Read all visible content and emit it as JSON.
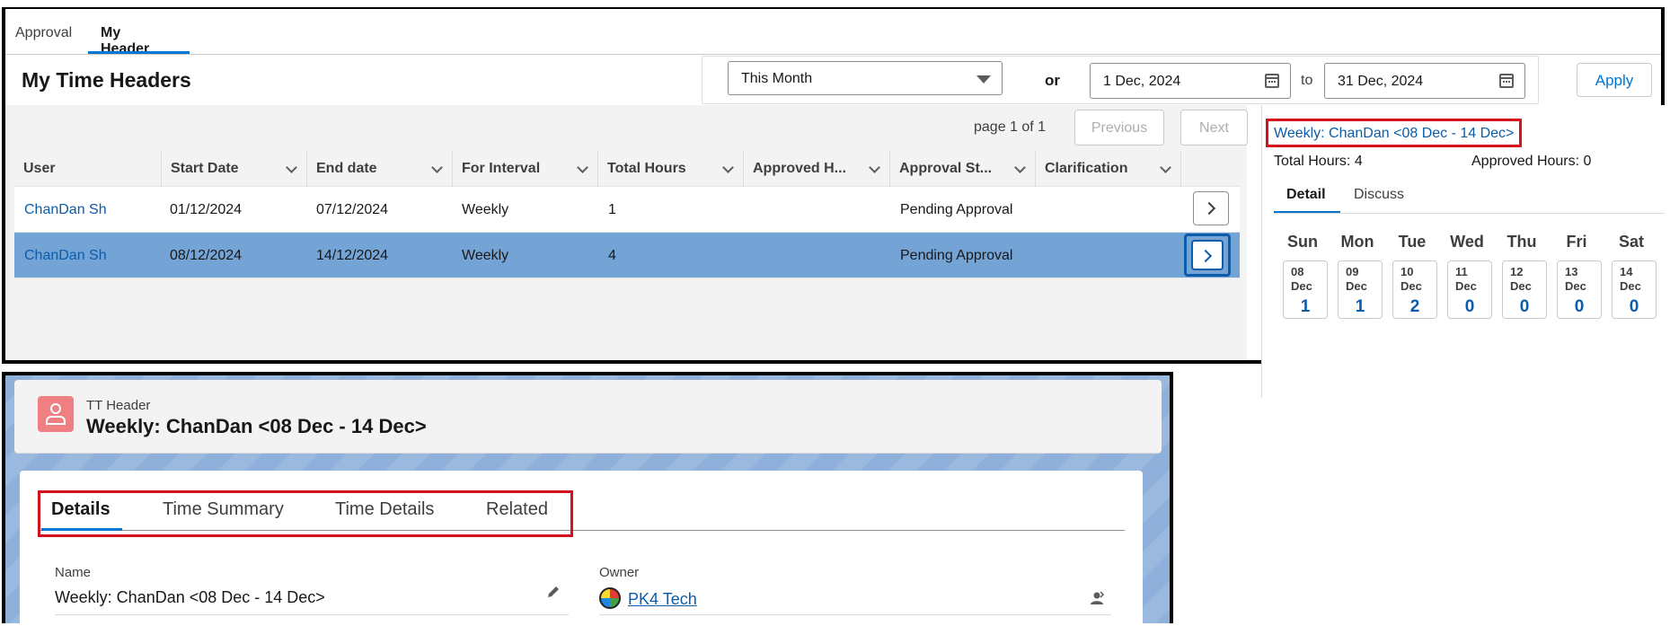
{
  "tabs": [
    "Approval",
    "My Header"
  ],
  "page_title": "My Time Headers",
  "filter": {
    "period": "This Month",
    "or_label": "or",
    "from_date": "1 Dec, 2024",
    "to_label": "to",
    "to_date": "31 Dec, 2024",
    "apply_label": "Apply"
  },
  "pager": {
    "text": "page 1 of 1",
    "prev_label": "Previous",
    "next_label": "Next"
  },
  "table": {
    "columns": [
      "User",
      "Start Date",
      "End date",
      "For Interval",
      "Total Hours",
      "Approved H...",
      "Approval St...",
      "Clarification"
    ],
    "rows": [
      {
        "user": "ChanDan Sh",
        "start": "01/12/2024",
        "end": "07/12/2024",
        "interval": "Weekly",
        "total": "1",
        "approved": "",
        "status": "Pending Approval",
        "clarification": ""
      },
      {
        "user": "ChanDan Sh",
        "start": "08/12/2024",
        "end": "14/12/2024",
        "interval": "Weekly",
        "total": "4",
        "approved": "",
        "status": "Pending Approval",
        "clarification": ""
      }
    ]
  },
  "side": {
    "title_link": "Weekly: ChanDan <08 Dec - 14 Dec>",
    "total_hours": "Total Hours: 4",
    "approved_hours": "Approved Hours: 0",
    "tabs": [
      "Detail",
      "Discuss"
    ],
    "days": [
      {
        "name": "Sun",
        "day": "08",
        "month": "Dec",
        "value": "1"
      },
      {
        "name": "Mon",
        "day": "09",
        "month": "Dec",
        "value": "1"
      },
      {
        "name": "Tue",
        "day": "10",
        "month": "Dec",
        "value": "2"
      },
      {
        "name": "Wed",
        "day": "11",
        "month": "Dec",
        "value": "0"
      },
      {
        "name": "Thu",
        "day": "12",
        "month": "Dec",
        "value": "0"
      },
      {
        "name": "Fri",
        "day": "13",
        "month": "Dec",
        "value": "0"
      },
      {
        "name": "Sat",
        "day": "14",
        "month": "Dec",
        "value": "0"
      }
    ]
  },
  "record": {
    "object_type": "TT Header",
    "title": "Weekly: ChanDan <08 Dec - 14 Dec>",
    "tabs": [
      "Details",
      "Time Summary",
      "Time Details",
      "Related"
    ],
    "name_label": "Name",
    "name_value": "Weekly: ChanDan <08 Dec - 14 Dec>",
    "owner_label": "Owner",
    "owner_value": "PK4 Tech"
  },
  "colors": {
    "accent": "#0176d3",
    "link": "#0b5cab",
    "highlight_box": "#d8121b",
    "selected_row": "#74a4d6"
  }
}
